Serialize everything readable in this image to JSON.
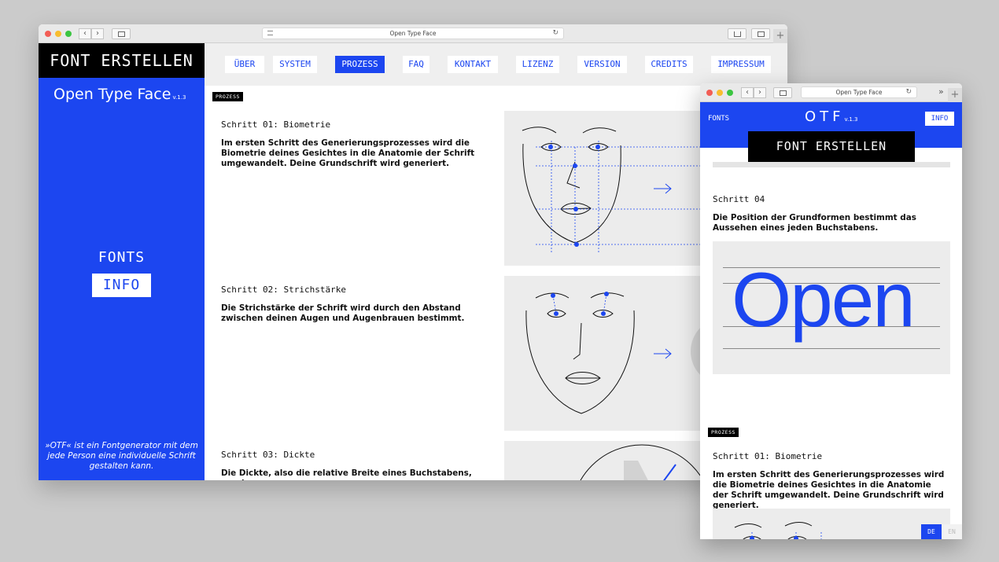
{
  "main_window": {
    "tab_title": "Open Type Face",
    "logo": "FONT ERSTELLEN",
    "sidebar": {
      "title": "Open Type Face",
      "version": "v.1.3",
      "fonts": "FONTS",
      "info": "INFO",
      "quote": "»OTF« ist ein Fontgenerator mit dem jede Person eine individuelle Schrift gestalten kann."
    },
    "nav": [
      "ÜBER",
      "SYSTEM",
      "PROZESS",
      "FAQ",
      "KONTAKT",
      "LIZENZ",
      "VERSION",
      "CREDITS",
      "IMPRESSUM"
    ],
    "nav_active": "PROZESS",
    "tag": "PROZESS",
    "steps": [
      {
        "title": "Schritt 01: Biometrie",
        "text": "Im ersten Schritt des Generierungsprozesses wird die Biometrie deines Gesichtes in die Anatomie der Schrift umgewandelt. Deine Grundschrift wird generiert."
      },
      {
        "title": "Schritt 02: Strichstärke",
        "text": "Die Strichstärke der Schrift wird durch den Abstand zwischen deinen Augen und Augenbrauen bestimmt."
      },
      {
        "title": "Schritt 03: Dickte",
        "text": "Die Dickte, also die relative Breite eines Buchstabens, wurde"
      }
    ]
  },
  "small_window": {
    "tab_title": "Open Type Face",
    "fonts": "FONTS",
    "logo": "OTF",
    "version": "v.1.3",
    "info": "INFO",
    "create": "FONT ERSTELLEN",
    "step4_title": "Schritt 04",
    "step4_text": "Die Position der Grundformen bestimmt das Aussehen eines jeden Buchstabens.",
    "sample_word": "Open",
    "tag": "PROZESS",
    "step1_title": "Schritt 01: Biometrie",
    "step1_text": "Im ersten Schritt des Generierungsprozesses wird die Biometrie deines Gesichtes in die Anatomie der Schrift umgewandelt. Deine Grundschrift wird generiert.",
    "lang_de": "DE",
    "lang_en": "EN"
  },
  "colors": {
    "accent": "#1c46f0",
    "black": "#000000",
    "panel": "#ececec",
    "background": "#cbcbcb"
  }
}
